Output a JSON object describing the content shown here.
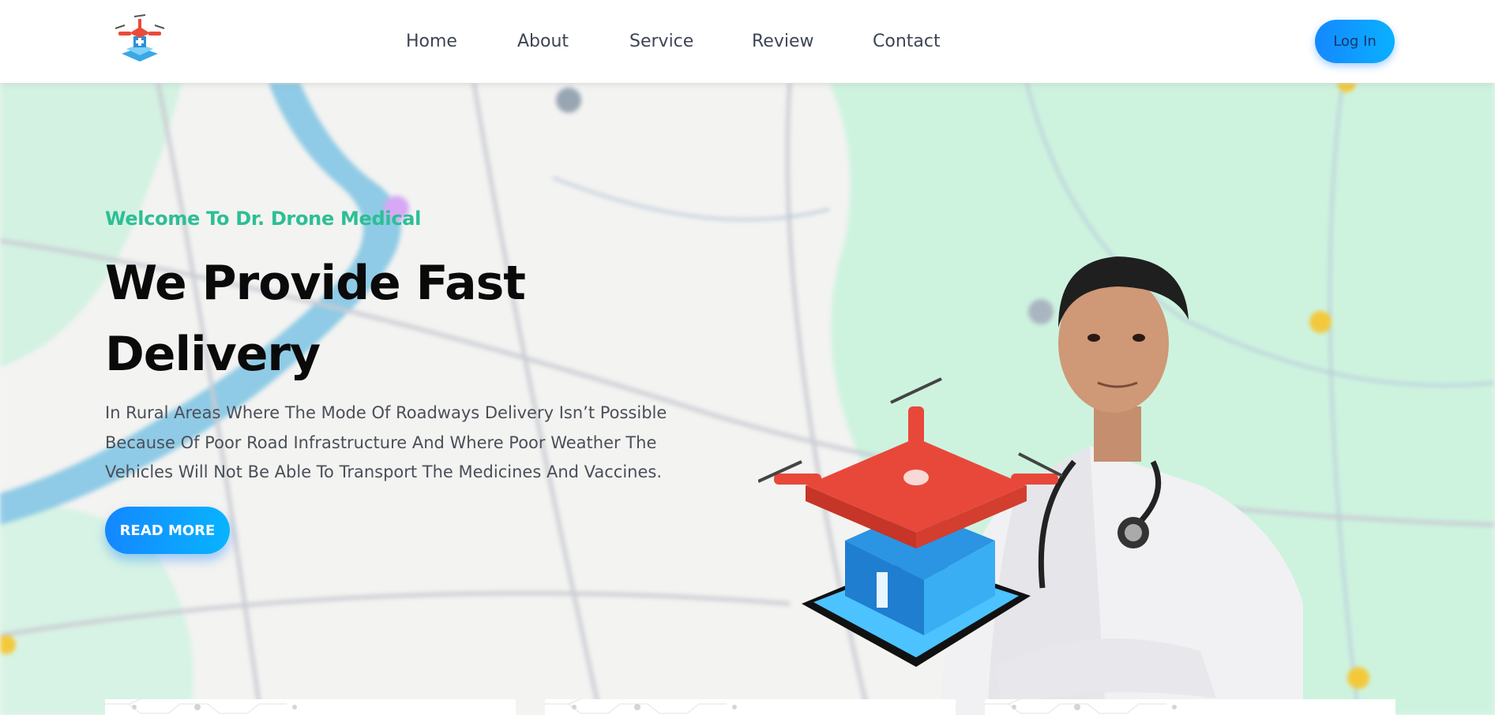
{
  "header": {
    "logo_icon": "drone-medical-logo-icon",
    "nav": [
      {
        "label": "Home"
      },
      {
        "label": "About"
      },
      {
        "label": "Service"
      },
      {
        "label": "Review"
      },
      {
        "label": "Contact"
      }
    ],
    "login_label": "Log In"
  },
  "hero": {
    "welcome": "Welcome To Dr. Drone Medical",
    "title": "We Provide Fast Delivery",
    "description": "In Rural Areas Where The Mode Of Roadways Delivery Isn’t Possible Because Of Poor Road Infrastructure And Where Poor Weather The Vehicles Will Not Be Able To Transport The Medicines And Vaccines.",
    "read_more_label": "READ MORE",
    "background_icon": "map-background",
    "illustration_icon": "doctor-with-drone-illustration"
  },
  "colors": {
    "accent_green": "#2cbf95",
    "button_blue": "#0a9cff",
    "title": "#0a0a0a",
    "body_text": "#4a4f59"
  }
}
